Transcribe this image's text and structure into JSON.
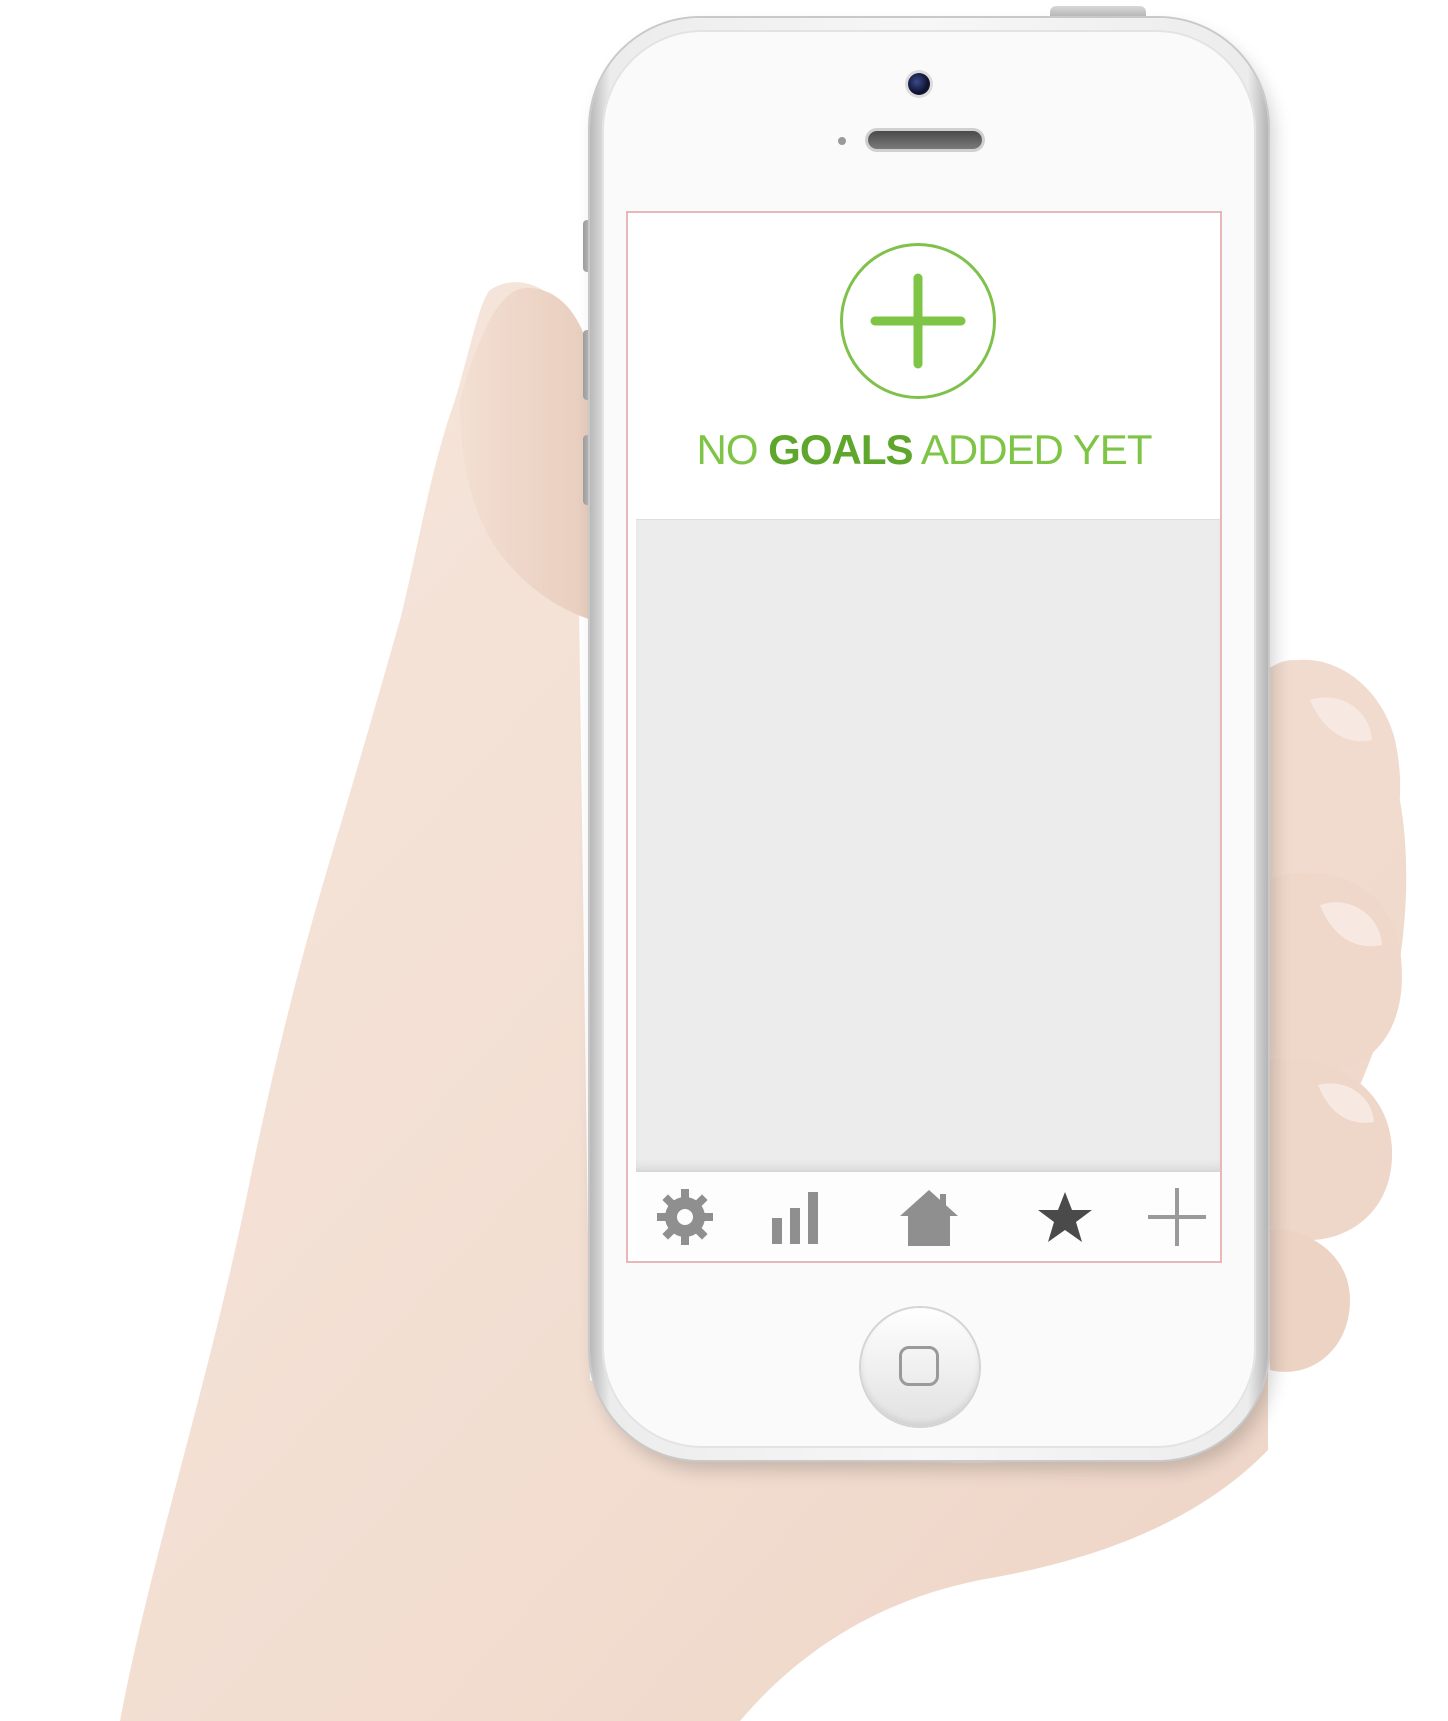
{
  "empty_state": {
    "prefix": "NO ",
    "emphasis": "GOALS",
    "suffix": " ADDED YET"
  },
  "tab_bar": {
    "tabs": [
      {
        "icon": "gear-icon"
      },
      {
        "icon": "bar-chart-icon"
      },
      {
        "icon": "home-icon"
      },
      {
        "icon": "star-icon"
      },
      {
        "icon": "plus-icon"
      }
    ]
  },
  "colors": {
    "accent_green": "#7ec445",
    "accent_green_dark": "#5fa62c",
    "tab_icon_gray": "#8f8f8f",
    "star_dark": "#4a4a4a",
    "list_background": "#ececec"
  }
}
